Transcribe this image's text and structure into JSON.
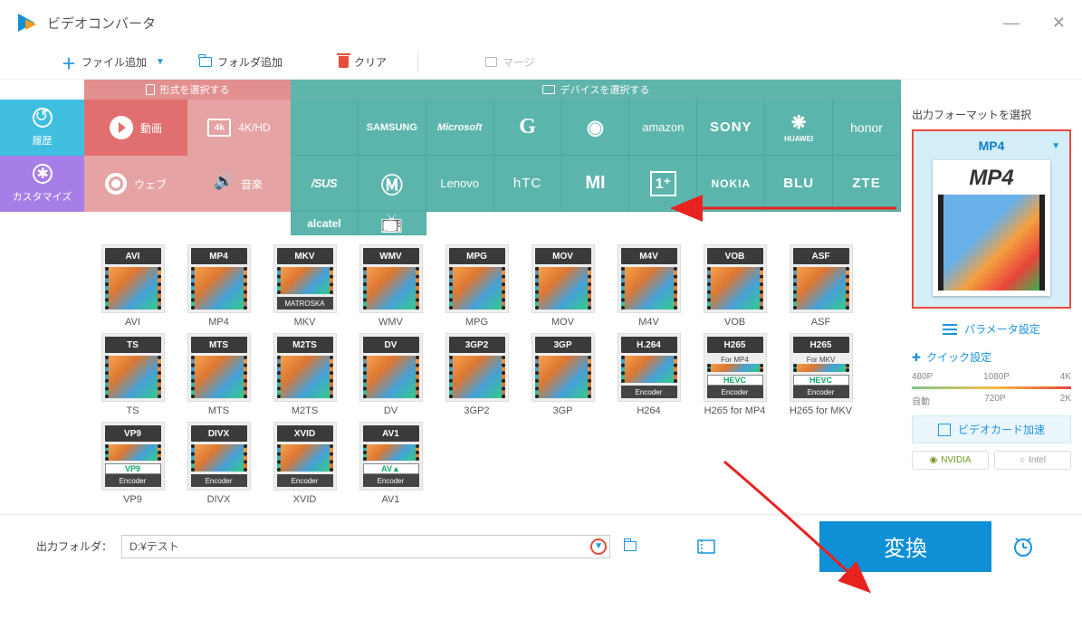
{
  "app": {
    "title": "ビデオコンバータ"
  },
  "toolbar": {
    "add_file": "ファイル追加",
    "add_folder": "フォルダ追加",
    "clear": "クリア",
    "merge": "マージ"
  },
  "cat": {
    "format": "形式を選択する",
    "device": "デバイスを選択する"
  },
  "left_tabs": {
    "history": "履歴",
    "custom": "カスタマイズ"
  },
  "types": {
    "video": "動画",
    "fourk": "4K/HD",
    "web": "ウェブ",
    "audio": "音楽"
  },
  "brands_row1": [
    "",
    "SAMSUNG",
    "Microsoft",
    "G",
    "",
    "amazon",
    "SONY",
    "HUAWEI",
    "honor",
    "/SUS"
  ],
  "brands_row2": [
    "",
    "Lenovo",
    "hTC",
    "MI",
    "",
    "NOKIA",
    "BLU",
    "ZTE",
    "alcatel",
    ""
  ],
  "formats_r1": [
    {
      "badge": "AVI",
      "label": "AVI"
    },
    {
      "badge": "MP4",
      "label": "MP4"
    },
    {
      "badge": "MKV",
      "label": "MKV",
      "sub": "MATROSKA"
    },
    {
      "badge": "WMV",
      "label": "WMV"
    },
    {
      "badge": "MPG",
      "label": "MPG"
    },
    {
      "badge": "MOV",
      "label": "MOV"
    },
    {
      "badge": "M4V",
      "label": "M4V"
    },
    {
      "badge": "VOB",
      "label": "VOB"
    },
    {
      "badge": "ASF",
      "label": "ASF"
    },
    {
      "badge": "TS",
      "label": "TS"
    }
  ],
  "formats_r2": [
    {
      "badge": "MTS",
      "label": "MTS"
    },
    {
      "badge": "M2TS",
      "label": "M2TS"
    },
    {
      "badge": "DV",
      "label": "DV"
    },
    {
      "badge": "3GP2",
      "label": "3GP2"
    },
    {
      "badge": "3GP",
      "label": "3GP"
    },
    {
      "badge": "H.264",
      "label": "H264",
      "sub": "Encoder"
    },
    {
      "badge": "H265",
      "label": "H265 for MP4",
      "sub": "Encoder",
      "mid": "HEVC",
      "mid2": "For MP4"
    },
    {
      "badge": "H265",
      "label": "H265 for MKV",
      "sub": "Encoder",
      "mid": "HEVC",
      "mid2": "For MKV"
    },
    {
      "badge": "VP9",
      "label": "VP9",
      "sub": "Encoder",
      "mid": "VP9"
    },
    {
      "badge": "DIVX",
      "label": "DIVX",
      "sub": "Encoder"
    }
  ],
  "formats_r3": [
    {
      "badge": "XVID",
      "label": "XVID",
      "sub": "Encoder"
    },
    {
      "badge": "AV1",
      "label": "AV1",
      "sub": "Encoder",
      "mid": "AV▲"
    }
  ],
  "right": {
    "title": "出力フォーマットを選択",
    "selected": "MP4",
    "thumb_big": "MP4",
    "param": "パラメータ設定",
    "quick": "クイック設定",
    "res_top": [
      "480P",
      "1080P",
      "4K"
    ],
    "res_bot": [
      "自動",
      "720P",
      "2K"
    ],
    "gpu_accel": "ビデオカード加速",
    "nvidia": "NVIDIA",
    "intel": "Intel"
  },
  "bottom": {
    "out_label": "出力フォルダ：",
    "path": "D:¥テスト",
    "convert": "変換"
  }
}
